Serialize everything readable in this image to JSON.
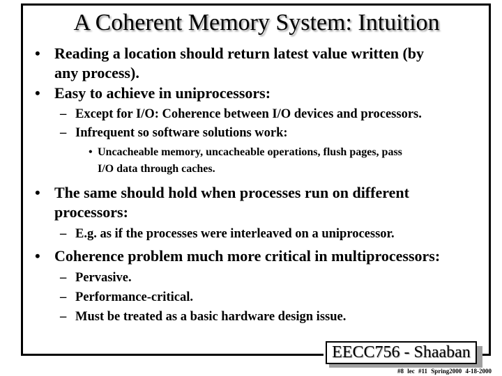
{
  "slide": {
    "title": "A Coherent Memory System:  Intuition",
    "bullet_glyph": "•",
    "dash_glyph": "–",
    "items": [
      {
        "level": 1,
        "lines": [
          "Reading a location should return latest value written (by",
          "any process)."
        ]
      },
      {
        "level": 1,
        "lines": [
          "Easy to achieve in uniprocessors:"
        ]
      },
      {
        "level": 2,
        "lines": [
          "Except for I/O:  Coherence between I/O devices and processors."
        ]
      },
      {
        "level": 2,
        "lines": [
          "Infrequent so software solutions work:"
        ]
      },
      {
        "level": 3,
        "lines": [
          "Uncacheable memory, uncacheable operations, flush pages, pass",
          "I/O data through caches."
        ]
      },
      {
        "level": 1,
        "lines": [
          "The same should hold when processes run on different",
          "processors:"
        ]
      },
      {
        "level": 2,
        "lines": [
          "E.g. as if the processes were interleaved on a uniprocessor."
        ]
      },
      {
        "level": 1,
        "lines": [
          "Coherence problem much more critical in multiprocessors:"
        ]
      },
      {
        "level": 2,
        "lines": [
          "Pervasive."
        ]
      },
      {
        "level": 2,
        "lines": [
          "Performance-critical."
        ]
      },
      {
        "level": 2,
        "lines": [
          "Must be treated as a basic hardware design issue."
        ]
      }
    ]
  },
  "logo": {
    "text": "EECC756 - Shaaban"
  },
  "footer": {
    "text": "#8  lec #11  Spring2000  4-18-2000"
  }
}
